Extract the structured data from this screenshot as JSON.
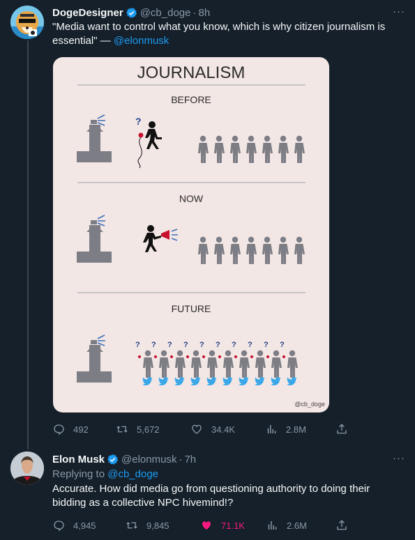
{
  "tweet1": {
    "name": "DogeDesigner",
    "handle": "@cb_doge",
    "time": "8h",
    "text": "\"Media want to control what you know, which is why citizen journalism is essential\" — ",
    "mention": "@elonmusk",
    "more": "···",
    "image": {
      "title": "JOURNALISM",
      "sections": [
        "BEFORE",
        "NOW",
        "FUTURE"
      ],
      "watermark": "@cb_doge"
    },
    "stats": {
      "replies": "492",
      "retweets": "5,672",
      "likes": "34.4K",
      "views": "2.8M"
    }
  },
  "tweet2": {
    "name": "Elon Musk",
    "handle": "@elonmusk",
    "time": "7h",
    "replying_prefix": "Replying to ",
    "replying_to": "@cb_doge",
    "text": "Accurate. How did media go from questioning authority to doing their bidding as a collective NPC hivemind!?",
    "more": "···",
    "stats": {
      "replies": "4,945",
      "retweets": "9,845",
      "likes": "71.1K",
      "views": "2.6M"
    }
  },
  "icons": {
    "verified": "verified-badge-icon",
    "reply": "reply-icon",
    "retweet": "retweet-icon",
    "like": "heart-icon",
    "views": "views-icon",
    "share": "share-icon"
  },
  "colors": {
    "background": "#15202b",
    "accent": "#1d9bf0",
    "like_active": "#f91880",
    "muted": "#8b98a5"
  }
}
